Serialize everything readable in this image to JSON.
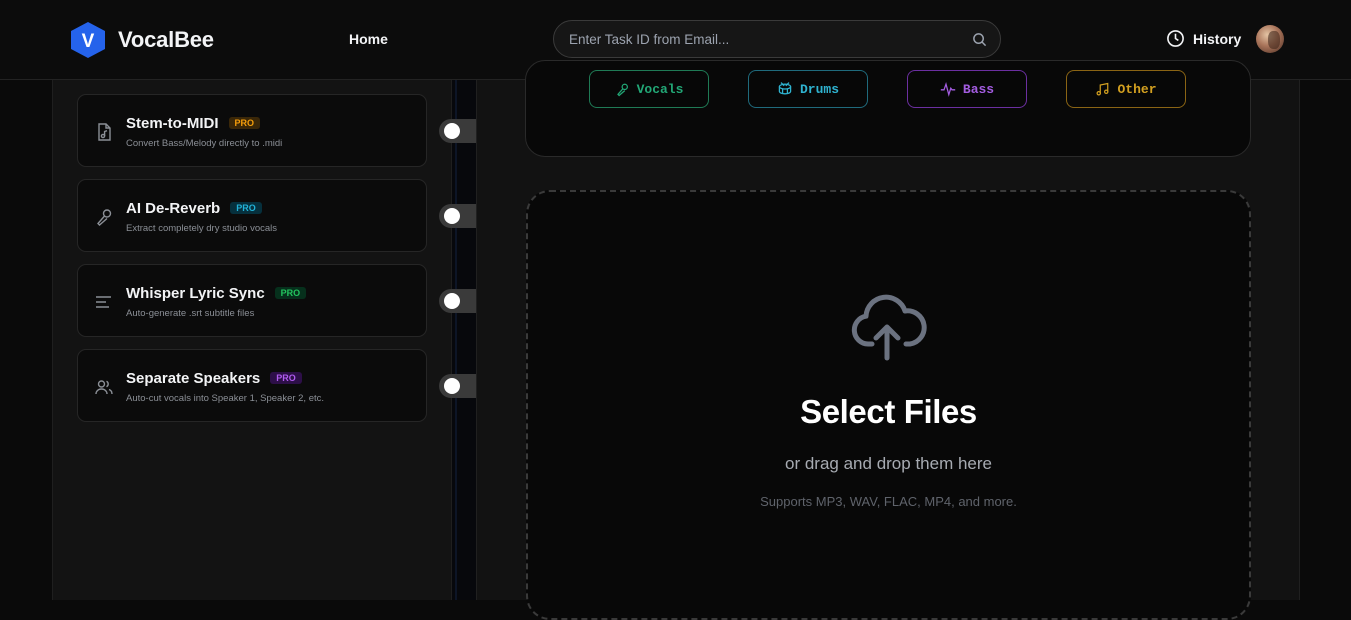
{
  "header": {
    "brand": "VocalBee",
    "logo_letter": "V",
    "nav_home": "Home",
    "search_placeholder": "Enter Task ID from Email...",
    "history_label": "History"
  },
  "features": [
    {
      "title": "Stem-to-MIDI",
      "badge": "PRO",
      "badge_color": "#f59e0b",
      "description": "Convert Bass/Melody directly to .midi",
      "icon": "music-file-icon",
      "enabled": false
    },
    {
      "title": "AI De-Reverb",
      "badge": "PRO",
      "badge_color": "#22b3d9",
      "description": "Extract completely dry studio vocals",
      "icon": "microphone-icon",
      "enabled": false
    },
    {
      "title": "Whisper Lyric Sync",
      "badge": "PRO",
      "badge_color": "#22c55e",
      "description": "Auto-generate .srt subtitle files",
      "icon": "text-lines-icon",
      "enabled": false
    },
    {
      "title": "Separate Speakers",
      "badge": "PRO",
      "badge_color": "#b15cf0",
      "description": "Auto-cut vocals into Speaker 1, Speaker 2, etc.",
      "icon": "users-icon",
      "enabled": false
    }
  ],
  "stems": [
    {
      "label": "Vocals",
      "icon": "microphone-icon",
      "color": "#22a776"
    },
    {
      "label": "Drums",
      "icon": "drum-icon",
      "color": "#2fb3d0"
    },
    {
      "label": "Bass",
      "icon": "waveform-icon",
      "color": "#a35ce0"
    },
    {
      "label": "Other",
      "icon": "music-note-icon",
      "color": "#d3a020"
    }
  ],
  "upload": {
    "title": "Select Files",
    "subtitle": "or drag and drop them here",
    "supported": "Supports MP3, WAV, FLAC, MP4, and more."
  }
}
